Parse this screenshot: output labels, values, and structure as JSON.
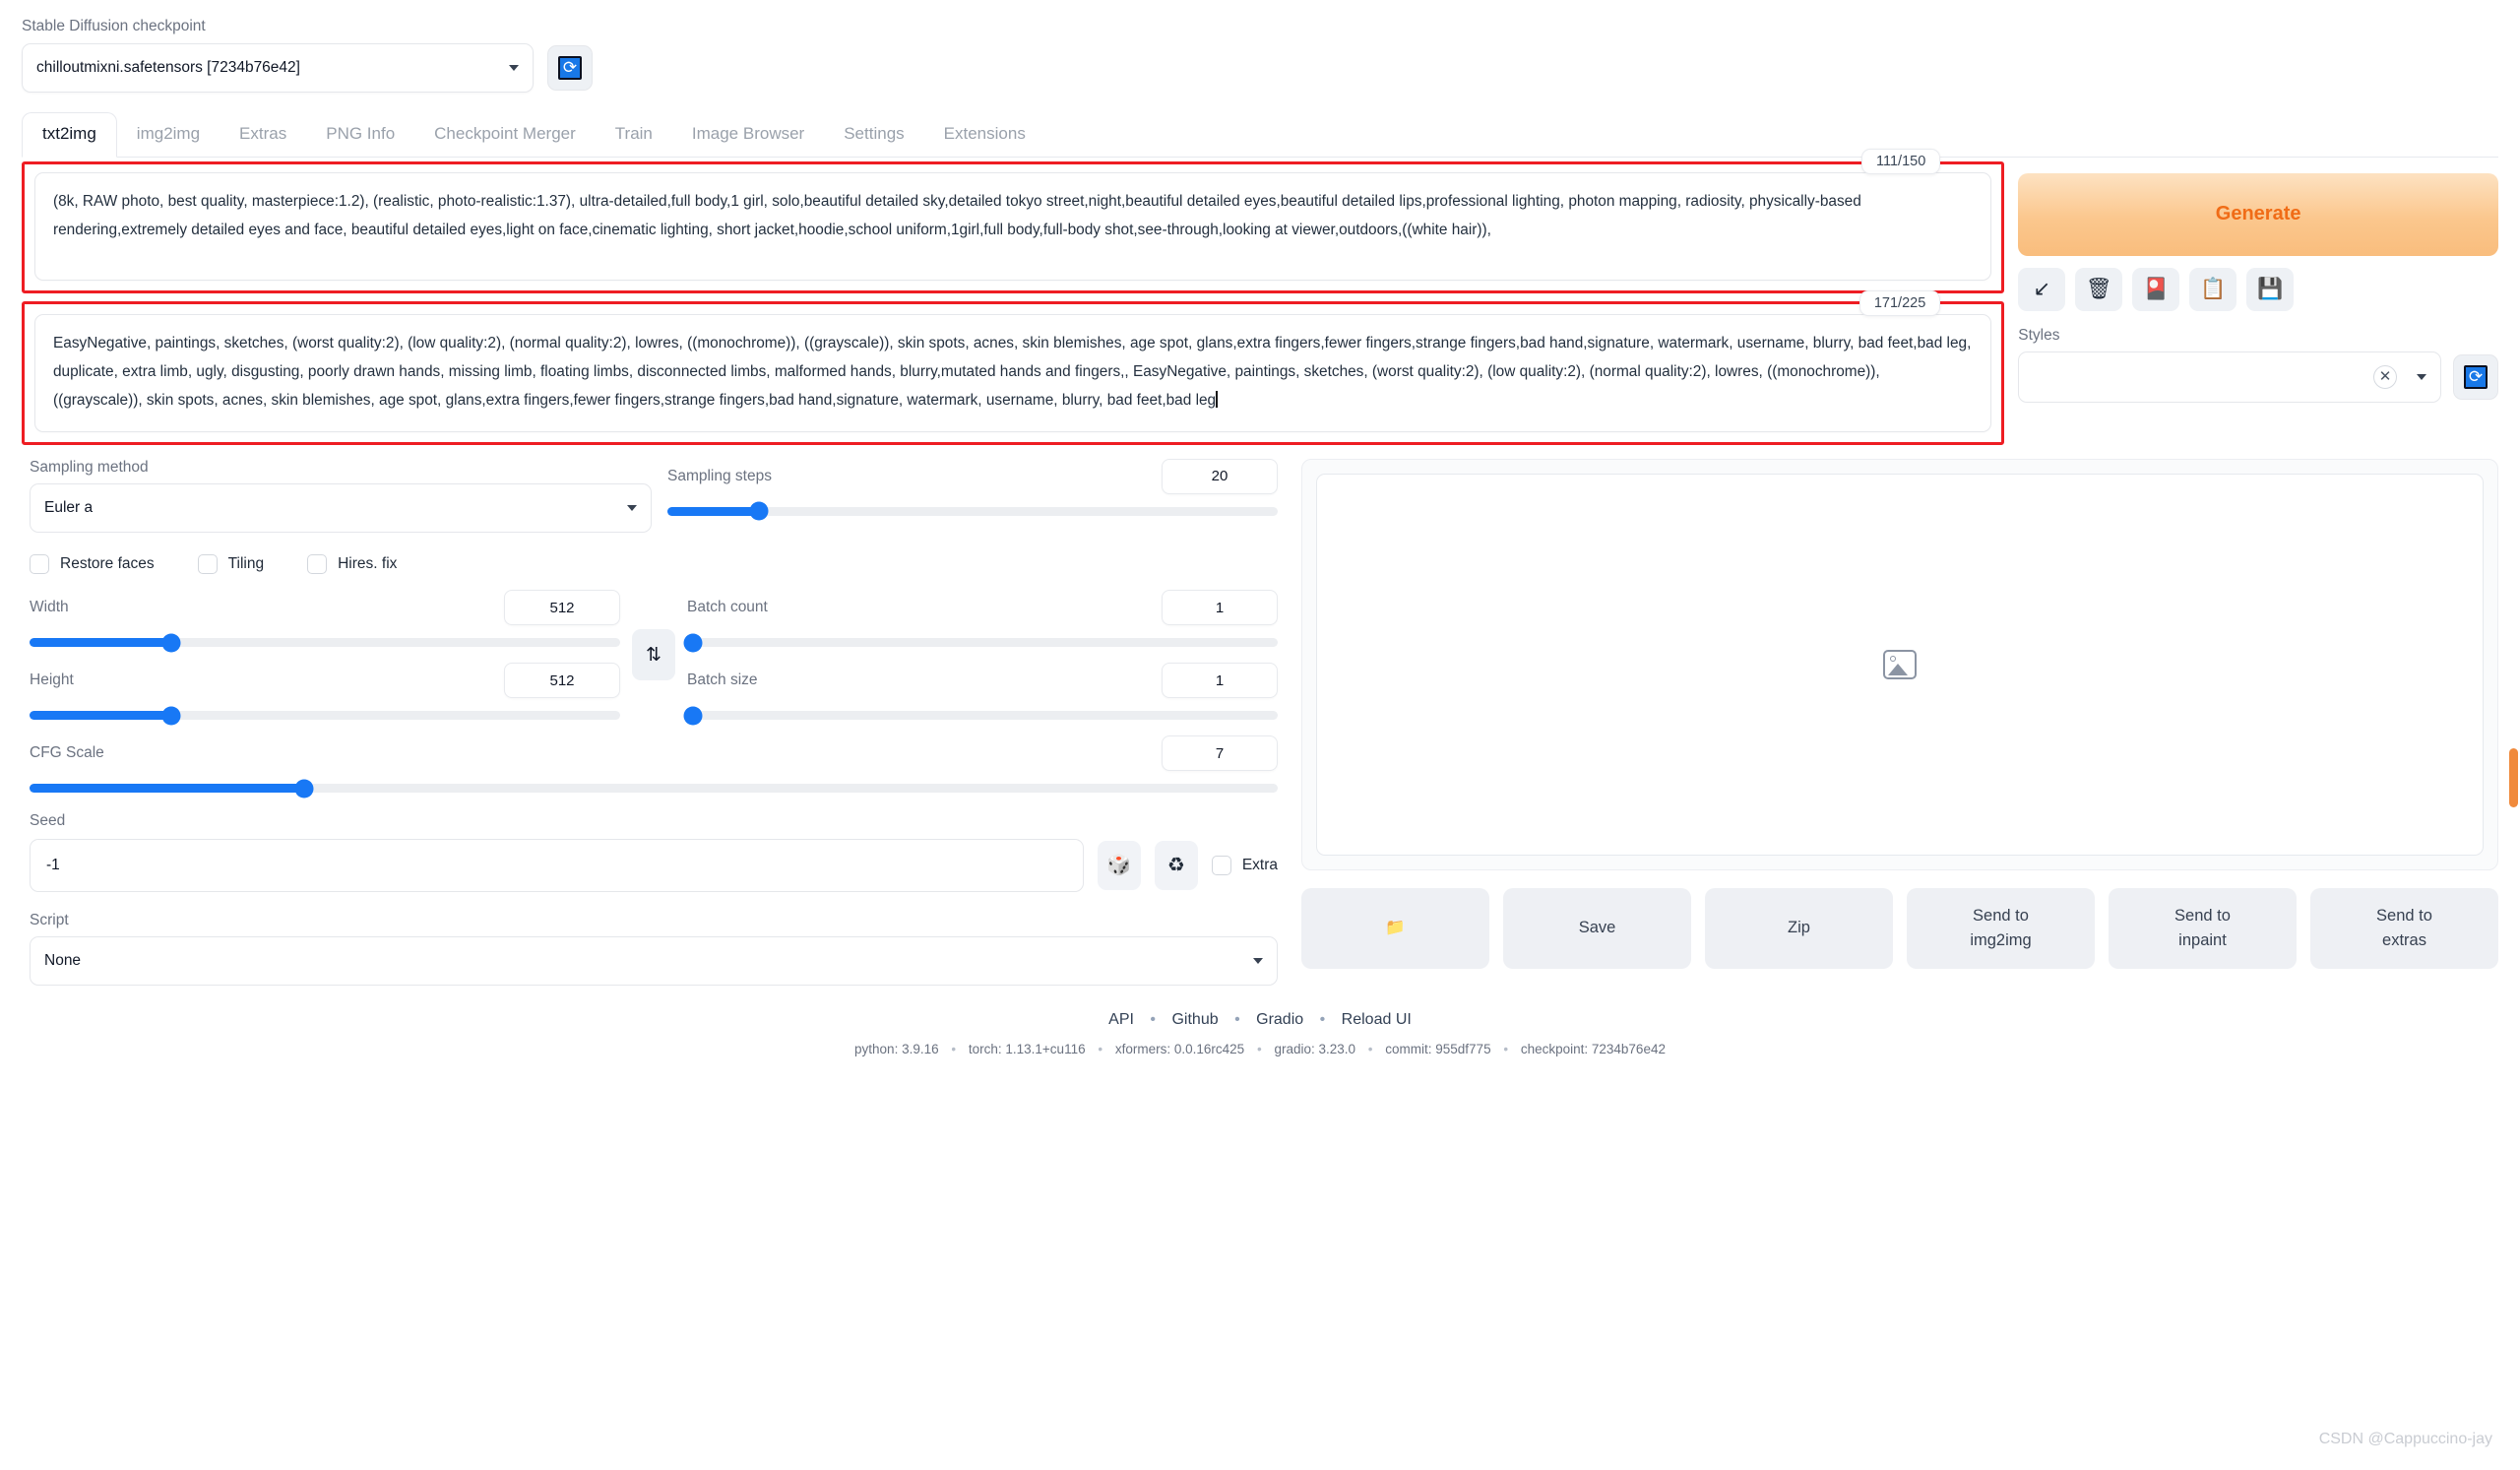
{
  "checkpoint": {
    "label": "Stable Diffusion checkpoint",
    "value": "chilloutmixni.safetensors [7234b76e42]",
    "refresh_icon": "refresh-icon"
  },
  "tabs": [
    {
      "label": "txt2img",
      "active": true
    },
    {
      "label": "img2img",
      "active": false
    },
    {
      "label": "Extras",
      "active": false
    },
    {
      "label": "PNG Info",
      "active": false
    },
    {
      "label": "Checkpoint Merger",
      "active": false
    },
    {
      "label": "Train",
      "active": false
    },
    {
      "label": "Image Browser",
      "active": false
    },
    {
      "label": "Settings",
      "active": false
    },
    {
      "label": "Extensions",
      "active": false
    }
  ],
  "prompt": {
    "positive": "(8k, RAW photo, best quality, masterpiece:1.2), (realistic, photo-realistic:1.37), ultra-detailed,full body,1 girl, solo,beautiful detailed sky,detailed tokyo street,night,beautiful detailed eyes,beautiful detailed lips,professional lighting, photon mapping, radiosity, physically-based rendering,extremely detailed eyes and face, beautiful detailed eyes,light on face,cinematic lighting, short jacket,hoodie,school uniform,1girl,full body,full-body shot,see-through,looking at viewer,outdoors,((white hair)),",
    "positive_counter": "111/150",
    "negative": "EasyNegative, paintings, sketches, (worst quality:2), (low quality:2), (normal quality:2), lowres, ((monochrome)), ((grayscale)), skin spots, acnes, skin blemishes, age spot, glans,extra fingers,fewer fingers,strange fingers,bad hand,signature, watermark, username, blurry, bad feet,bad leg, duplicate, extra limb, ugly, disgusting, poorly drawn hands, missing limb, floating limbs, disconnected limbs, malformed hands, blurry,mutated hands and fingers,, EasyNegative, paintings, sketches, (worst quality:2), (low quality:2), (normal quality:2), lowres, ((monochrome)), ((grayscale)), skin spots, acnes, skin blemishes, age spot, glans,extra fingers,fewer fingers,strange fingers,bad hand,signature, watermark, username, blurry, bad feet,bad leg",
    "negative_counter": "171/225"
  },
  "generate": {
    "label": "Generate",
    "accent_color": "#f06c17",
    "icons": [
      {
        "name": "arrow-down-left-icon",
        "glyph": "↙"
      },
      {
        "name": "trash-icon",
        "glyph": "🗑"
      },
      {
        "name": "paintcard-icon",
        "glyph": "🎴"
      },
      {
        "name": "clipboard-icon",
        "glyph": "📋"
      },
      {
        "name": "floppy-save-icon",
        "glyph": "💾"
      }
    ]
  },
  "styles": {
    "label": "Styles",
    "value": "",
    "clear_glyph": "✕",
    "refresh_icon": "refresh-icon"
  },
  "settings": {
    "sampling_method": {
      "label": "Sampling method",
      "value": "Euler a"
    },
    "sampling_steps": {
      "label": "Sampling steps",
      "value": "20",
      "percent": 15
    },
    "restore_faces": {
      "label": "Restore faces",
      "checked": false
    },
    "tiling": {
      "label": "Tiling",
      "checked": false
    },
    "hires_fix": {
      "label": "Hires. fix",
      "checked": false
    },
    "width": {
      "label": "Width",
      "value": "512",
      "percent": 24
    },
    "height": {
      "label": "Height",
      "value": "512",
      "percent": 24
    },
    "batch_count": {
      "label": "Batch count",
      "value": "1",
      "percent": 1
    },
    "batch_size": {
      "label": "Batch size",
      "value": "1",
      "percent": 1
    },
    "cfg_scale": {
      "label": "CFG Scale",
      "value": "7",
      "percent": 22
    },
    "swap_glyph": "⇅",
    "seed": {
      "label": "Seed",
      "value": "-1"
    },
    "dice_glyph": "🎲",
    "recycle_glyph": "♻",
    "extra": {
      "label": "Extra",
      "checked": false
    },
    "script": {
      "label": "Script",
      "value": "None"
    }
  },
  "output": {
    "placeholder_icon": "image-placeholder-icon",
    "buttons": [
      {
        "name": "open-folder-button",
        "label": "📁",
        "is_icon": true
      },
      {
        "name": "save-button",
        "label": "Save",
        "is_icon": false
      },
      {
        "name": "zip-button",
        "label": "Zip",
        "is_icon": false
      },
      {
        "name": "send-to-img2img-button",
        "label": "Send to\nimg2img",
        "is_icon": false
      },
      {
        "name": "send-to-inpaint-button",
        "label": "Send to\ninpaint",
        "is_icon": false
      },
      {
        "name": "send-to-extras-button",
        "label": "Send to\nextras",
        "is_icon": false
      }
    ]
  },
  "footer": {
    "links": [
      "API",
      "Github",
      "Gradio",
      "Reload UI"
    ],
    "versions": [
      "python: 3.9.16",
      "torch: 1.13.1+cu116",
      "xformers: 0.0.16rc425",
      "gradio: 3.23.0",
      "commit: 955df775",
      "checkpoint: 7234b76e42"
    ]
  },
  "watermark": "CSDN @Cappuccino-jay"
}
